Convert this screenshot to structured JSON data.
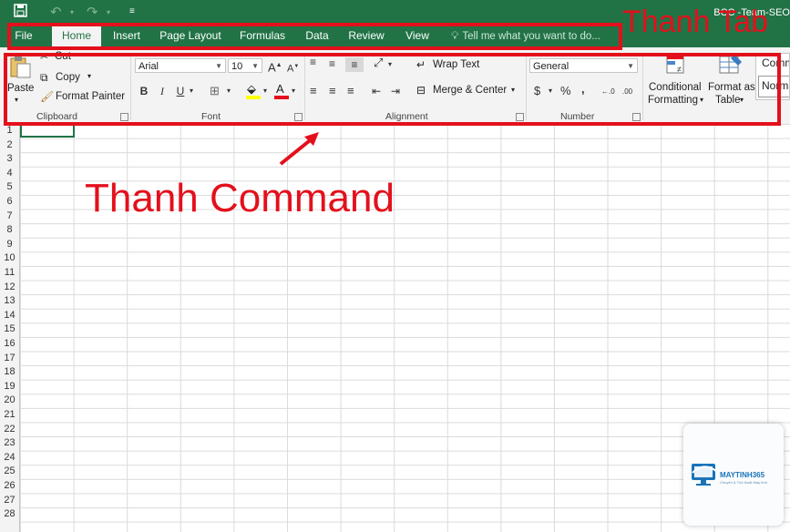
{
  "title_bar": {
    "save_icon": "save-icon",
    "undo_icon": "undo-icon",
    "redo_icon": "redo-icon",
    "customize_icon": "customize-quick-access-icon",
    "doc_title": "BCC -Team-SEO"
  },
  "tabs": [
    {
      "label": "File",
      "active": false
    },
    {
      "label": "Home",
      "active": true
    },
    {
      "label": "Insert",
      "active": false
    },
    {
      "label": "Page Layout",
      "active": false
    },
    {
      "label": "Formulas",
      "active": false
    },
    {
      "label": "Data",
      "active": false
    },
    {
      "label": "Review",
      "active": false
    },
    {
      "label": "View",
      "active": false
    }
  ],
  "tell_me": {
    "placeholder": "Tell me what you want to do..."
  },
  "ribbon": {
    "clipboard": {
      "label": "Clipboard",
      "paste": "Paste",
      "cut": "Cut",
      "copy": "Copy",
      "format_painter": "Format Painter"
    },
    "font": {
      "label": "Font",
      "font_name": "Arial",
      "font_size": "10",
      "bold": "B",
      "italic": "I",
      "underline": "U",
      "grow": "A",
      "shrink": "A",
      "font_color_letter": "A",
      "fill_color": "#ffff00",
      "font_color": "#e3101c"
    },
    "alignment": {
      "label": "Alignment",
      "wrap_text": "Wrap Text",
      "merge_center": "Merge & Center"
    },
    "number": {
      "label": "Number",
      "format": "General",
      "currency": "$",
      "percent": "%",
      "comma": ",",
      "inc_decimal": "←.0",
      "dec_decimal": ".00"
    },
    "styles": {
      "conditional_1": "Conditional",
      "conditional_2": "Formatting",
      "format_table_1": "Format as",
      "format_table_2": "Table",
      "cell_style_1": "Comma",
      "cell_style_2": "Normal"
    }
  },
  "rows": [
    "1",
    "2",
    "3",
    "4",
    "5",
    "6",
    "7",
    "8",
    "9",
    "10",
    "11",
    "12",
    "13",
    "14",
    "15",
    "16",
    "17",
    "18",
    "19",
    "20",
    "21",
    "22",
    "23",
    "24",
    "25",
    "26",
    "27",
    "28"
  ],
  "annotations": {
    "tab_label": "Thanh Tab",
    "command_label": "Thanh Command",
    "color": "#e3101c"
  },
  "watermark": {
    "name": "MAYTINH365",
    "tagline": "Chuyên & Thủ thuật Máy tính"
  },
  "colors": {
    "accent": "#217346",
    "ribbon": "#f3f3f3",
    "gridline": "#dadada"
  }
}
